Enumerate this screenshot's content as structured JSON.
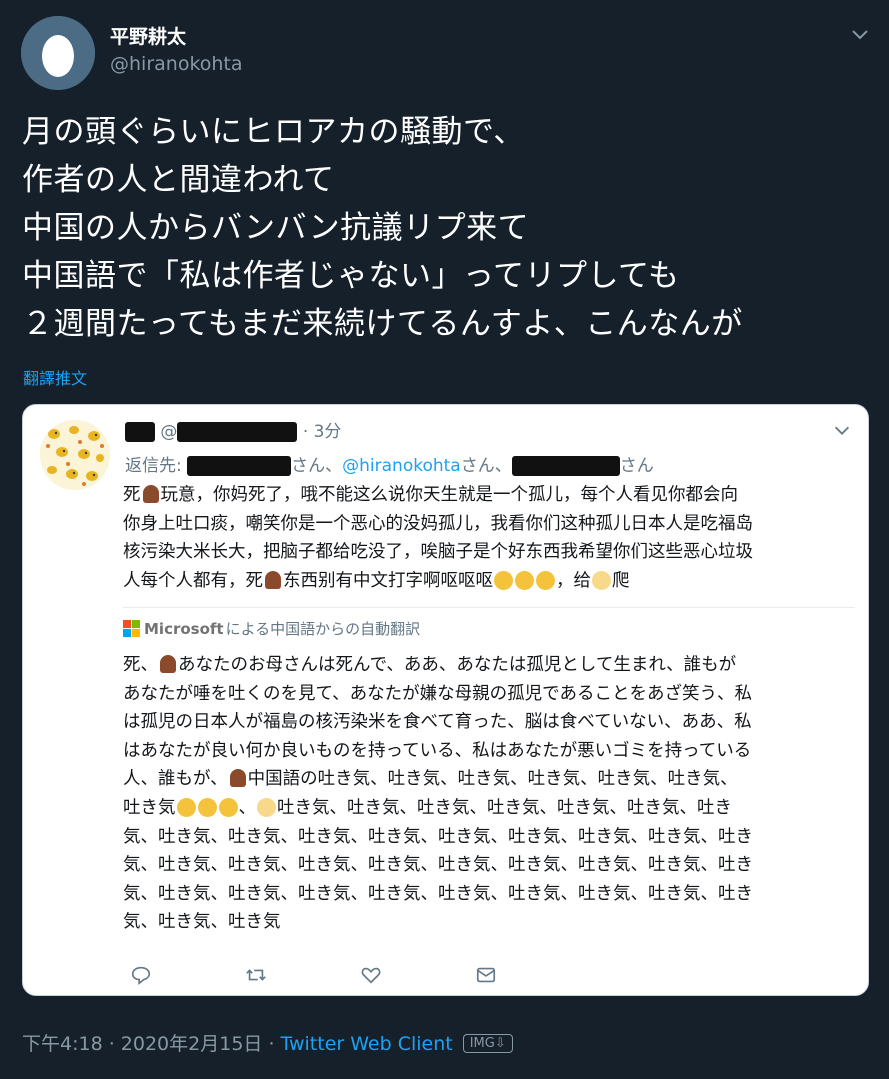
{
  "author": {
    "display_name": "平野耕太",
    "handle": "@hiranokohta"
  },
  "tweet": {
    "lines": [
      "月の頭ぐらいにヒロアカの騒動で、",
      "作者の人と間違われて",
      "中国の人からバンバン抗議リプ来て",
      "中国語で「私は作者じゃない」ってリプしても",
      "２週間たってもまだ来続けてるんすよ、こんなんが"
    ],
    "translate_label": "翻譯推文"
  },
  "quote": {
    "handle_prefix": "@",
    "time": "· 3分",
    "reply_prefix": "返信先:",
    "reply_mention": "@hiranokohta",
    "san": "さん、",
    "san_last": "さん",
    "body": {
      "l1a": "死",
      "l1b": "玩意，你妈死了，哦不能这么说你天生就是一个孤儿，每个人看见你都会向",
      "l2": "你身上吐口痰，嘲笑你是一个恶心的没妈孤儿，我看你们这种孤儿日本人是吃福岛",
      "l3": "核污染大米长大，把脑子都给吃没了，唉脑子是个好东西我希望你们这些恶心垃圾",
      "l4a": "人每个人都有，死",
      "l4b": "东西别有中文打字啊呕呕呕",
      "l4c": "，给",
      "l4d": "爬"
    },
    "translation_brand": "Microsoft",
    "translation_label": "による中国語からの自動翻訳",
    "translation": {
      "l1a": "死、",
      "l1b": "あなたのお母さんは死んで、ああ、あなたは孤児として生まれ、誰もが",
      "l2": "あなたが唾を吐くのを見て、あなたが嫌な母親の孤児であることをあざ笑う、私",
      "l3": "は孤児の日本人が福島の核汚染米を食べて育った、脳は食べていない、ああ、私",
      "l4": "はあなたが良い何か良いものを持っている、私はあなたが悪いゴミを持っている",
      "l5a": "人、誰もが、",
      "l5b": "中国語の吐き気、吐き気、吐き気、吐き気、吐き気、吐き気、",
      "l6a": "吐き気",
      "l6b": "、",
      "l6c": "吐き気、吐き気、吐き気、吐き気、吐き気、吐き気、吐き",
      "l7": "気、吐き気、吐き気、吐き気、吐き気、吐き気、吐き気、吐き気、吐き気、吐き",
      "l8": "気、吐き気、吐き気、吐き気、吐き気、吐き気、吐き気、吐き気、吐き気、吐き",
      "l9": "気、吐き気、吐き気、吐き気、吐き気、吐き気、吐き気、吐き気、吐き気、吐き",
      "l10": "気、吐き気、吐き気"
    }
  },
  "footer": {
    "timestamp": "下午4:18 · 2020年2月15日 · ",
    "client": "Twitter Web Client",
    "img_badge": "IMG⇩"
  },
  "colors": {
    "background": "#15202b",
    "accent": "#1da1f2",
    "muted": "#8899a6"
  },
  "icons": [
    "egg-avatar",
    "chevron-down-icon",
    "reply-icon",
    "retweet-icon",
    "like-icon",
    "dm-icon",
    "microsoft-logo-icon",
    "horse-emoji",
    "tired-face-emoji",
    "pleading-face-emoji"
  ]
}
